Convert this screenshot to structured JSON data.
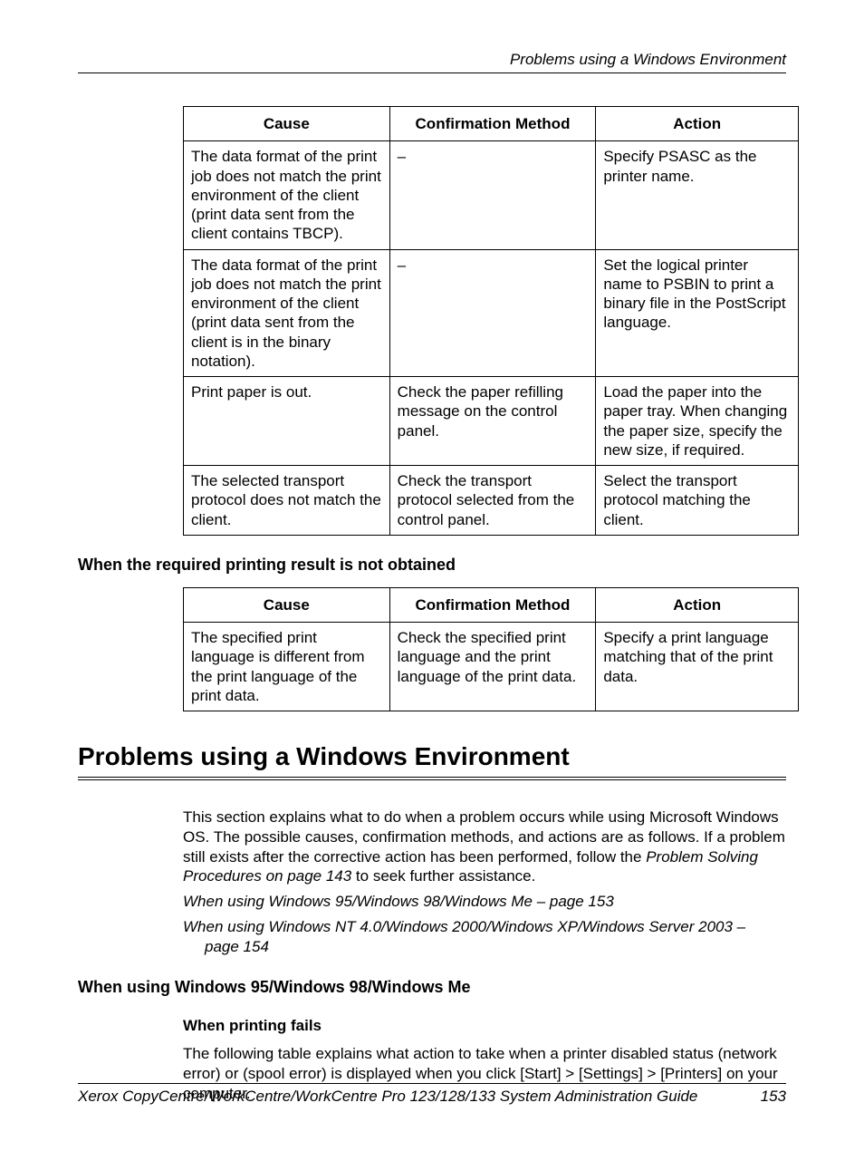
{
  "running_header": "Problems using a Windows Environment",
  "table1": {
    "headers": {
      "cause": "Cause",
      "confirmation": "Confirmation Method",
      "action": "Action"
    },
    "rows": [
      {
        "cause": "The data format of the print job does not match the print environment of the client (print data sent from the client contains TBCP).",
        "confirmation": "–",
        "action": "Specify PSASC as the printer name."
      },
      {
        "cause": "The data format of the print job does not match the print environment of the client (print data sent from the client is in the binary notation).",
        "confirmation": "–",
        "action": "Set the logical printer name to PSBIN to print a binary file in the PostScript language."
      },
      {
        "cause": "Print paper is out.",
        "confirmation": "Check the paper refilling message on the control panel.",
        "action": "Load the paper into the paper tray. When changing the paper size, specify the new size, if required."
      },
      {
        "cause": "The selected transport protocol does not match the client.",
        "confirmation": "Check the transport protocol selected from the control panel.",
        "action": "Select the transport protocol matching the client."
      }
    ]
  },
  "subheading1": "When the required printing result is not obtained",
  "table2": {
    "headers": {
      "cause": "Cause",
      "confirmation": "Confirmation Method",
      "action": "Action"
    },
    "rows": [
      {
        "cause": "The specified print language is different from the print language of the print data.",
        "confirmation": "Check the specified print language and the print language of the print data.",
        "action": "Specify a print language matching that of the print data."
      }
    ]
  },
  "section_title": "Problems using a Windows Environment",
  "intro": {
    "p1a": "This section explains what to do when a problem occurs while using Microsoft Windows OS. The possible causes, confirmation methods, and actions are as follows. If a problem still exists after the corrective action has been performed, follow the ",
    "p1b_italic": "Problem Solving Procedures on page 143",
    "p1c": " to seek further assistance.",
    "ref1": "When using Windows 95/Windows 98/Windows Me – page 153",
    "ref2a": "When using Windows NT 4.0/Windows 2000/Windows XP/Windows Server 2003 –",
    "ref2b": "page 154"
  },
  "subheading2": "When using Windows 95/Windows 98/Windows Me",
  "subsub1": "When printing fails",
  "para2": "The following table explains what action to take when a printer disabled status (network error) or (spool error) is displayed when you click [Start] > [Settings] > [Printers] on your computer.",
  "footer": {
    "title": "Xerox CopyCentre/WorkCentre/WorkCentre Pro 123/128/133 System Administration Guide",
    "page": "153"
  }
}
